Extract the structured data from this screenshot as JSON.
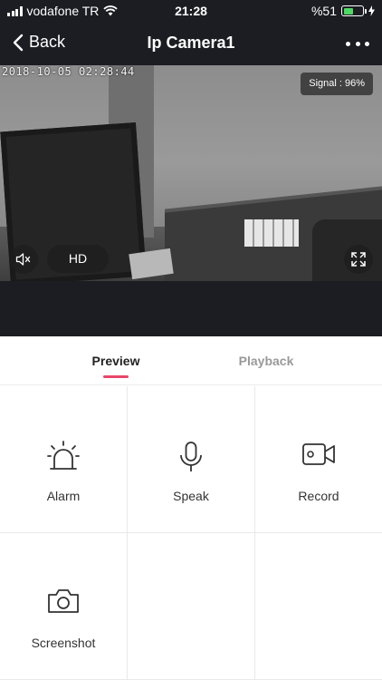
{
  "status_bar": {
    "carrier": "vodafone TR",
    "time": "21:28",
    "battery_text": "%51",
    "battery_level": 0.51,
    "battery_color": "#4cd964"
  },
  "nav": {
    "back_label": "Back",
    "title": "Ip Camera1",
    "more_icon": "more-icon"
  },
  "camera": {
    "timestamp": "2018-10-05 02:28:44",
    "signal_label": "Signal : 96%",
    "quality_label": "HD",
    "mute_icon": "speaker-muted-icon",
    "fullscreen_icon": "fullscreen-icon"
  },
  "tabs": [
    {
      "label": "Preview",
      "active": true
    },
    {
      "label": "Playback",
      "active": false
    }
  ],
  "accent_color": "#e8476a",
  "actions": [
    {
      "label": "Alarm",
      "icon": "alarm-icon"
    },
    {
      "label": "Speak",
      "icon": "microphone-icon"
    },
    {
      "label": "Record",
      "icon": "video-camera-icon"
    },
    {
      "label": "Screenshot",
      "icon": "camera-icon"
    }
  ]
}
